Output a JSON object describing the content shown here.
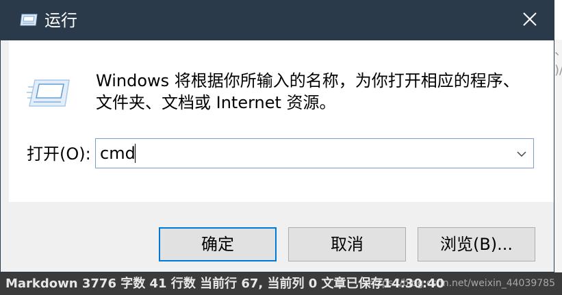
{
  "background": {
    "statusbar_text": "Markdown 3776 字数 41 行数 当前行 67, 当前列 0 文章已保存14:30:40",
    "watermark": "https://blog.csdn.net/weixin_44039785"
  },
  "dialog": {
    "title": "运行",
    "description_line1": "Windows 将根据你所输入的名称，为你打开相应的程序、",
    "description_line2": "文件夹、文档或 Internet 资源。",
    "open_label": "打开(O):",
    "open_value": "cmd",
    "buttons": {
      "ok": "确定",
      "cancel": "取消",
      "browse": "浏览(B)..."
    }
  },
  "colors": {
    "titlebar": "#2b3a4a",
    "accent": "#0078d7"
  }
}
